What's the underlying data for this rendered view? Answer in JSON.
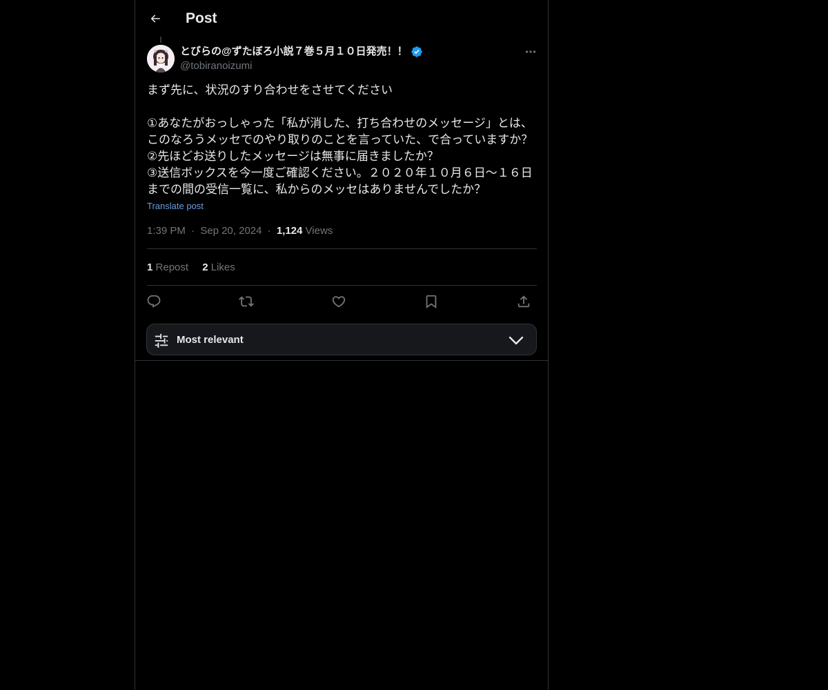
{
  "header": {
    "title": "Post",
    "back_icon": "arrow-left-icon"
  },
  "post": {
    "author": {
      "display_name": "とびらの@ずたぼろ小説７巻５月１０日発売！！",
      "handle": "@tobiranoizumi",
      "verified": true,
      "verified_color": "#1d9bf0"
    },
    "body_lines": [
      "まず先に、状況のすり合わせをさせてください",
      "",
      "①あなたがおっしゃった「私が消した、打ち合わせのメッセージ」とは、",
      "このなろうメッセでのやり取りのことを言っていた、で合っていますか？",
      "②先ほどお送りしたメッセージは無事に届きましたか？",
      "③送信ボックスを今一度ご確認ください。２０２０年１０月６日〜１６日",
      "までの間の受信一覧に、私からのメッセはありませんでしたか？"
    ],
    "translate_label": "Translate post",
    "time": "1:39 PM",
    "date": "Sep 20, 2024",
    "views_count": "1,124",
    "views_label": "Views",
    "separator": "·"
  },
  "stats": {
    "reposts_count": "1",
    "reposts_label": "Repost",
    "likes_count": "2",
    "likes_label": "Likes"
  },
  "actions": {
    "reply_icon": "reply-icon",
    "repost_icon": "repost-icon",
    "like_icon": "heart-icon",
    "bookmark_icon": "bookmark-icon",
    "share_icon": "share-icon"
  },
  "sort": {
    "label": "Most relevant"
  },
  "colors": {
    "background": "#000000",
    "text": "#e7e9ea",
    "muted": "#71767b",
    "link": "#1d9bf0",
    "border": "#2f3336"
  }
}
